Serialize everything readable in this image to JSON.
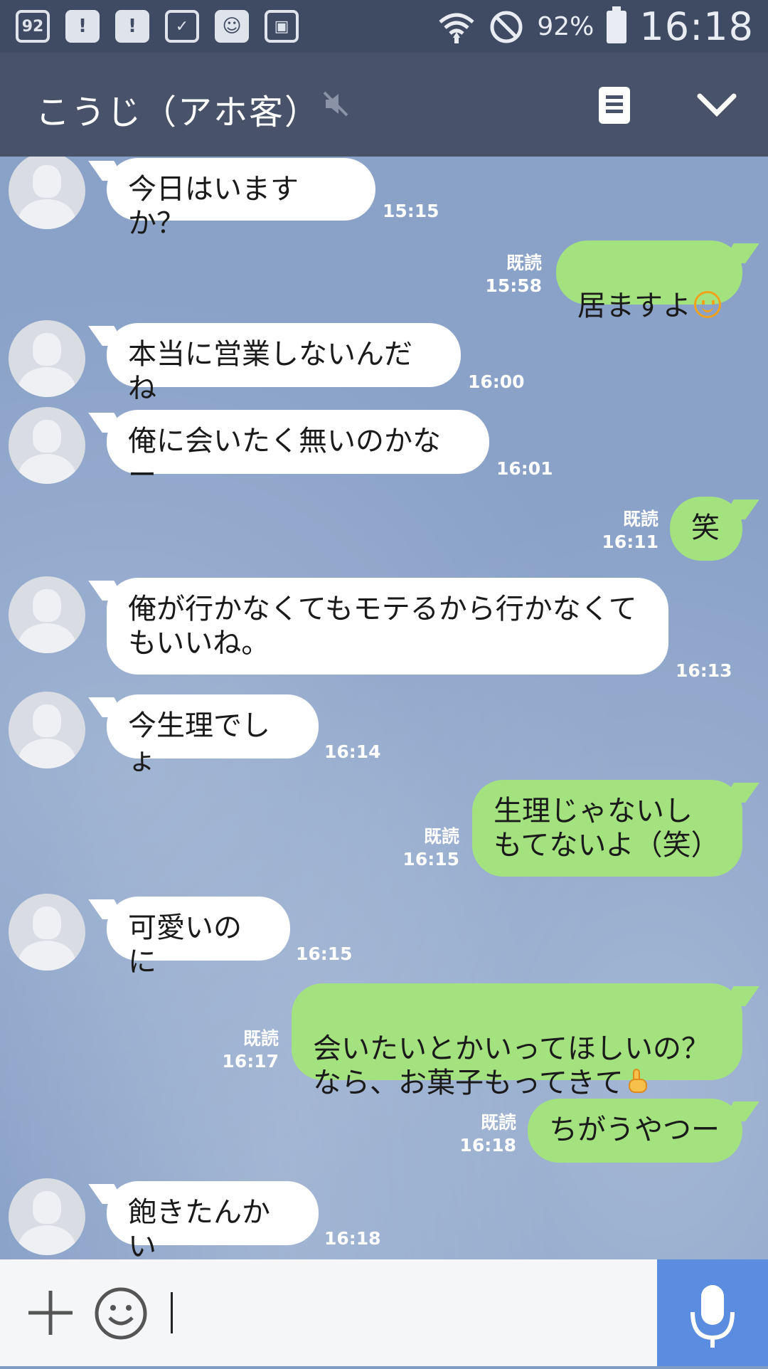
{
  "status_bar": {
    "left_icons": [
      "92",
      "!",
      "!",
      "✓",
      "☺",
      "▣"
    ],
    "battery_percent": "92%",
    "time": "16:18"
  },
  "header": {
    "title": "こうじ（アホ客）",
    "icons": [
      "mute-icon",
      "menu-icon",
      "chevron-down-icon"
    ]
  },
  "messages": [
    {
      "side": "in",
      "text": "今日はいますか？",
      "time": "15:15"
    },
    {
      "side": "out",
      "text": "居ますよ",
      "emoji": "smile",
      "read": "既読",
      "time": "15:58"
    },
    {
      "side": "in",
      "text": "本当に営業しないんだね",
      "time": "16:00"
    },
    {
      "side": "in",
      "text": "俺に会いたく無いのかなー",
      "time": "16:01"
    },
    {
      "side": "out",
      "text": "笑",
      "read": "既読",
      "time": "16:11"
    },
    {
      "side": "in",
      "text": "俺が行かなくてもモテるから行かなくて\nもいいね。",
      "time": "16:13"
    },
    {
      "side": "in",
      "text": "今生理でしょ",
      "time": "16:14"
    },
    {
      "side": "out",
      "text": "生理じゃないし\nもてないよ（笑）",
      "read": "既読",
      "time": "16:15"
    },
    {
      "side": "in",
      "text": "可愛いのに",
      "time": "16:15"
    },
    {
      "side": "out",
      "text": "会いたいとかいってほしいの？\nなら、お菓子もってきて",
      "emoji": "point",
      "read": "既読",
      "time": "16:17"
    },
    {
      "side": "out",
      "text": "ちがうやつー",
      "read": "既読",
      "time": "16:18"
    },
    {
      "side": "in",
      "text": "飽きたんかい",
      "time": "16:18"
    }
  ],
  "input": {
    "value": "",
    "icons": [
      "plus-icon",
      "smiley-icon",
      "mic-icon"
    ]
  },
  "colors": {
    "status_bar": "#3f4a63",
    "header": "#485369",
    "out_bubble": "#a3e27f",
    "in_bubble": "#ffffff",
    "mic_button": "#5a8ce0"
  }
}
